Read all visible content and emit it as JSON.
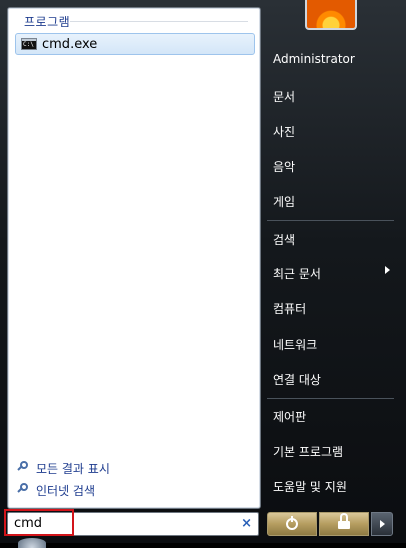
{
  "left": {
    "section_title": "프로그램",
    "result": {
      "label": "cmd.exe",
      "icon": "cmd-console-icon"
    },
    "links": [
      {
        "label": "모든 결과 표시",
        "icon": "search-icon"
      },
      {
        "label": "인터넷 검색",
        "icon": "search-icon"
      }
    ]
  },
  "search": {
    "value": "cmd",
    "clear_label": "×"
  },
  "right": {
    "items": [
      {
        "label": "Administrator"
      },
      {
        "label": "문서"
      },
      {
        "label": "사진"
      },
      {
        "label": "음악"
      },
      {
        "label": "게임"
      },
      {
        "label": "검색"
      },
      {
        "label": "최근 문서"
      },
      {
        "label": "컴퓨터"
      },
      {
        "label": "네트워크"
      },
      {
        "label": "연결 대상"
      },
      {
        "label": "제어판"
      },
      {
        "label": "기본 프로그램"
      },
      {
        "label": "도움말 및 지원"
      }
    ]
  },
  "cmd_icon_text": "C:\\",
  "colors": {
    "highlight_border": "#d2141a",
    "link": "#1e3c8f"
  }
}
